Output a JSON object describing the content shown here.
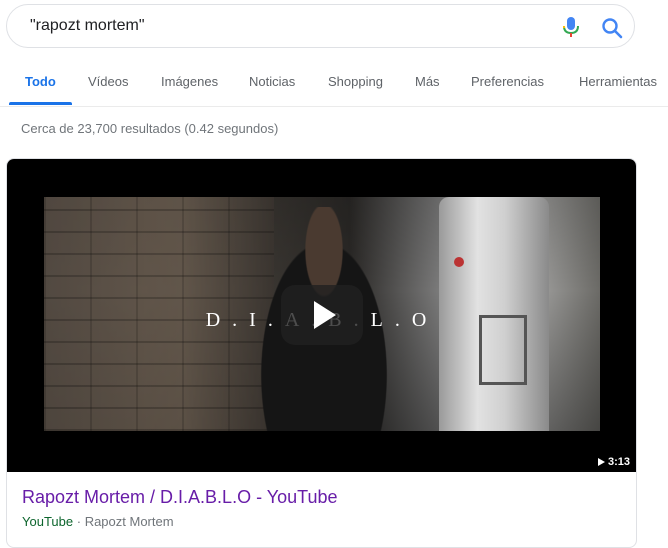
{
  "search": {
    "query": "\"rapozt mortem\"",
    "mic_icon": "microphone-icon",
    "search_icon": "search-icon",
    "colors": {
      "mic_blue": "#4285f4",
      "mic_red": "#ea4335",
      "mic_yellow": "#fbbc05",
      "mic_green": "#34a853",
      "search_blue": "#4285f4"
    }
  },
  "tabs": [
    {
      "label": "Todo",
      "active": true
    },
    {
      "label": "Vídeos"
    },
    {
      "label": "Imágenes"
    },
    {
      "label": "Noticias"
    },
    {
      "label": "Shopping"
    },
    {
      "label": "Más"
    },
    {
      "label": "Preferencias"
    },
    {
      "label": "Herramientas"
    }
  ],
  "result_stats": "Cerca de 23,700 resultados (0.42 segundos)",
  "video": {
    "overlay_text": "D.I.A.B.L.O",
    "duration": "3:13",
    "title": "Rapozt Mortem / D.I.A.B.L.O - YouTube",
    "site": "YouTube",
    "separator": "·",
    "channel": "Rapozt Mortem"
  },
  "colors": {
    "accent": "#1a73e8",
    "visited_link": "#681da8",
    "url_green": "#0d652d",
    "muted": "#70757a"
  }
}
